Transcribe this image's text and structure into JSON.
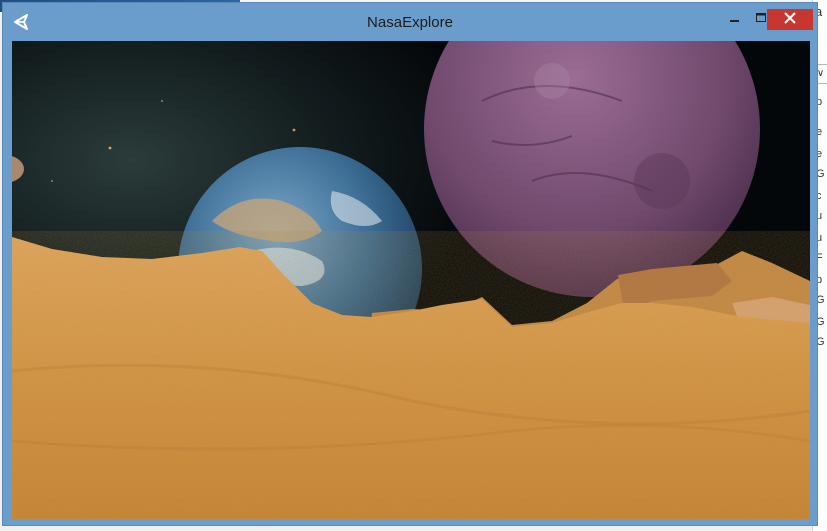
{
  "window": {
    "title": "NasaExplore",
    "controls": {
      "minimize": "minimize",
      "maximize": "maximize",
      "close": "close"
    }
  },
  "icons": {
    "app": "unity-icon",
    "minimize": "minimize-icon",
    "maximize": "maximize-icon",
    "close": "close-icon"
  },
  "background_app": {
    "title_char": "a",
    "dropdown_glyph": "∨",
    "lines": [
      "p",
      "e",
      "e",
      "G",
      "c",
      "u",
      "u",
      "F",
      "p",
      "G",
      "G",
      "G"
    ]
  },
  "colors": {
    "titlebar": "#6b9dcc",
    "close": "#c7372f",
    "sand": "#d89a4e",
    "space": "#05080c"
  }
}
